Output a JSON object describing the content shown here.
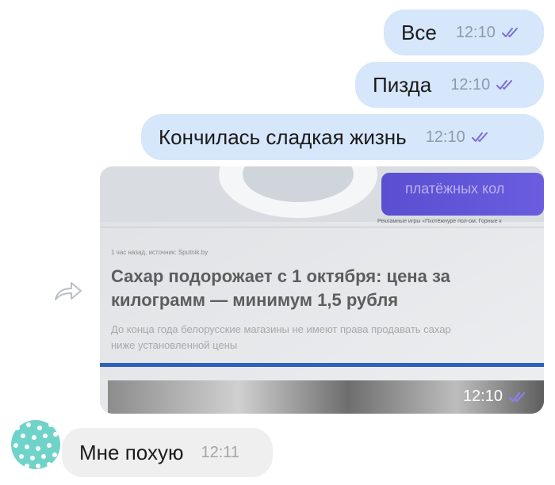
{
  "messages_out": [
    {
      "text": "Все",
      "time": "12:10"
    },
    {
      "text": "Пизда",
      "time": "12:10"
    },
    {
      "text": "Кончилась сладкая жизнь",
      "time": "12:10"
    }
  ],
  "photo_message": {
    "time": "12:10",
    "banner_text": "платёжных кол",
    "ad_caption": "Рекламные игры «Пхотёжнуре пол-ом. Горные к",
    "meta_line": "1 час назад, источник: Sputnik.by",
    "headline_line1": "Сахар подорожает с 1 октября: цена за",
    "headline_line2": "килограмм — минимум 1,5 рубля",
    "lead_line1": "До конца года белорусские магазины не имеют права продавать сахар",
    "lead_line2": "ниже установленной цены"
  },
  "message_in": {
    "text": "Мне похую",
    "time": "12:11"
  },
  "colors": {
    "outgoing_bubble": "#d6e6fb",
    "incoming_bubble": "#efefef",
    "read_ticks": "#7b6fd6",
    "avatar": "#6fd3c9"
  },
  "icons": {
    "forward": "forward-arrow-icon",
    "read": "double-check-icon"
  }
}
